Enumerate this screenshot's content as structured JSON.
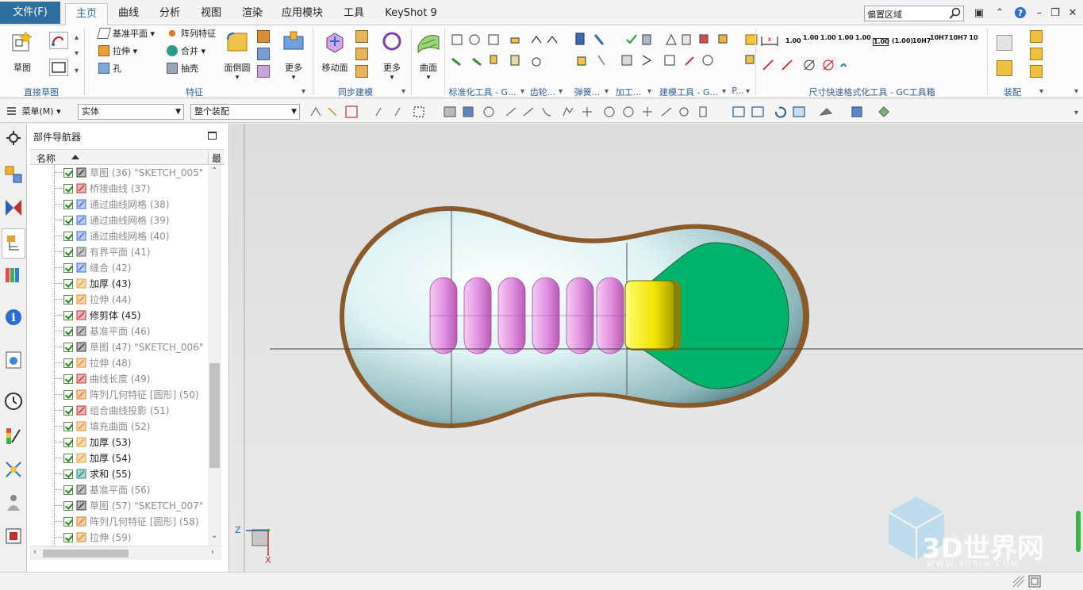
{
  "menubar": {
    "file": "文件(F)",
    "tabs": [
      "主页",
      "曲线",
      "分析",
      "视图",
      "渲染",
      "应用模块",
      "工具",
      "KeyShot 9"
    ],
    "search_text": "偏置区域"
  },
  "ribbon": {
    "sketch_label": "草图",
    "direct_sketch_group": "直接草图",
    "datum_plane": "基准平面",
    "pattern_feature": "阵列特征",
    "extrude": "拉伸",
    "unite": "合并",
    "hole": "孔",
    "shell": "抽壳",
    "edge_blend": "面倒圆",
    "more": "更多",
    "feature_group": "特征",
    "move_face": "移动面",
    "sync_group": "同步建模",
    "more2": "更多",
    "surface": "曲面",
    "std_tools": "标准化工具 - G...",
    "gear": "齿轮...",
    "spring": "弹簧...",
    "machining": "加工...",
    "modeling_tools": "建模工具 - G...",
    "p_dots": "P...",
    "dim_quick": "尺寸快速格式化工具 - GC工具箱",
    "assembly": "装配",
    "dims": [
      "1.00",
      "1.00",
      "1.00",
      "1.00",
      "1.00",
      "(1.00)",
      "10H7",
      "10H7",
      "10H7",
      "10"
    ]
  },
  "toolbar2": {
    "menu": "菜单(M)",
    "filter": "实体",
    "scope": "整个装配"
  },
  "navigator": {
    "title": "部件导航器",
    "col_name": "名称",
    "col_last": "最新",
    "rows": [
      {
        "name": "草图 (36) \"SKETCH_005\"",
        "dim": true,
        "icon": "sketch-icon"
      },
      {
        "name": "桥接曲线 (37)",
        "dim": true,
        "icon": "bridge-curve-icon"
      },
      {
        "name": "通过曲线网格 (38)",
        "dim": true,
        "icon": "curve-mesh-icon"
      },
      {
        "name": "通过曲线网格 (39)",
        "dim": true,
        "icon": "curve-mesh-icon"
      },
      {
        "name": "通过曲线网格 (40)",
        "dim": true,
        "icon": "curve-mesh-icon"
      },
      {
        "name": "有界平面 (41)",
        "dim": true,
        "icon": "bounded-plane-icon"
      },
      {
        "name": "缝合 (42)",
        "dim": true,
        "icon": "sew-icon"
      },
      {
        "name": "加厚 (43)",
        "dim": false,
        "icon": "thicken-icon"
      },
      {
        "name": "拉伸 (44)",
        "dim": true,
        "icon": "extrude-icon"
      },
      {
        "name": "修剪体 (45)",
        "dim": false,
        "icon": "trim-body-icon"
      },
      {
        "name": "基准平面 (46)",
        "dim": true,
        "icon": "datum-plane-icon"
      },
      {
        "name": "草图 (47) \"SKETCH_006\"",
        "dim": true,
        "icon": "sketch-icon"
      },
      {
        "name": "拉伸 (48)",
        "dim": true,
        "icon": "extrude-icon"
      },
      {
        "name": "曲线长度 (49)",
        "dim": true,
        "icon": "curve-length-icon"
      },
      {
        "name": "阵列几何特征 [圆形] (50)",
        "dim": true,
        "icon": "pattern-geometry-icon"
      },
      {
        "name": "组合曲线投影 (51)",
        "dim": true,
        "icon": "combined-projection-icon"
      },
      {
        "name": "填充曲面 (52)",
        "dim": true,
        "icon": "fill-surface-icon"
      },
      {
        "name": "加厚 (53)",
        "dim": false,
        "icon": "thicken-icon"
      },
      {
        "name": "加厚 (54)",
        "dim": false,
        "icon": "thicken-icon"
      },
      {
        "name": "求和 (55)",
        "dim": false,
        "icon": "unite-icon"
      },
      {
        "name": "基准平面 (56)",
        "dim": true,
        "icon": "datum-plane-icon"
      },
      {
        "name": "草图 (57) \"SKETCH_007\"",
        "dim": true,
        "icon": "sketch-icon"
      },
      {
        "name": "阵列几何特征 [圆形] (58)",
        "dim": true,
        "icon": "pattern-geometry-icon"
      },
      {
        "name": "拉伸 (59)",
        "dim": true,
        "icon": "extrude-icon"
      }
    ]
  },
  "viewport": {
    "axis_z": "Z",
    "axis_x": "X",
    "watermark_title": "3D世界网",
    "watermark_url": "WWW.3DSJW.COM"
  },
  "colors": {
    "accent": "#2c6e9e",
    "body_fill": "#d9f1f3",
    "rim": "#8b5a2b",
    "green_face": "#00b36b",
    "yellow_block": "#f2ec00",
    "pink_ribs": "#e8a2e6"
  }
}
